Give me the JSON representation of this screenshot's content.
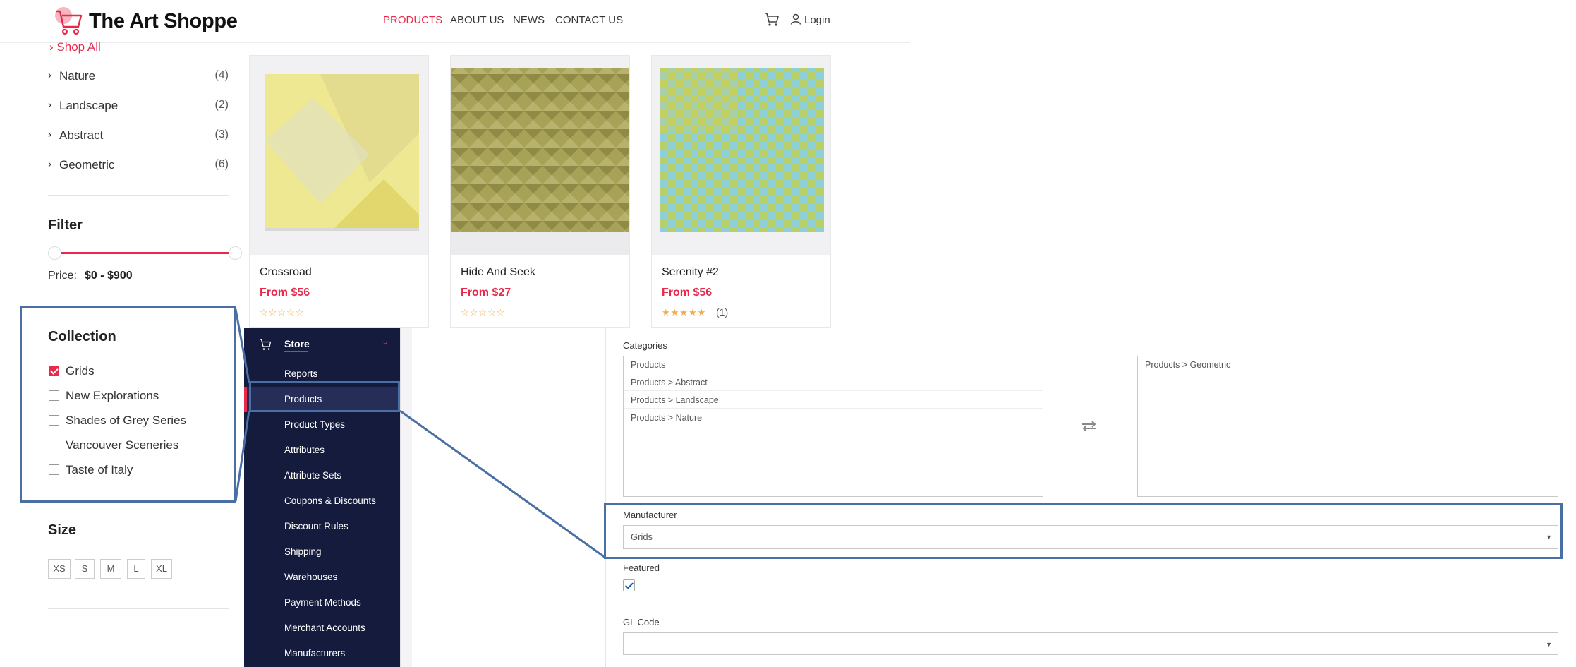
{
  "store": {
    "title": "The Art Shoppe",
    "nav": [
      "PRODUCTS",
      "ABOUT US",
      "NEWS",
      "CONTACT US"
    ],
    "login": "Login",
    "shop_all": "Shop All",
    "categories": [
      {
        "label": "Nature",
        "count": "(4)"
      },
      {
        "label": "Landscape",
        "count": "(2)"
      },
      {
        "label": "Abstract",
        "count": "(3)"
      },
      {
        "label": "Geometric",
        "count": "(6)"
      }
    ],
    "filter_title": "Filter",
    "price_label": "Price:",
    "price_range": "$0 - $900",
    "collection_title": "Collection",
    "collections": [
      {
        "label": "Grids",
        "checked": true
      },
      {
        "label": "New Explorations",
        "checked": false
      },
      {
        "label": "Shades of Grey Series",
        "checked": false
      },
      {
        "label": "Vancouver Sceneries",
        "checked": false
      },
      {
        "label": "Taste of Italy",
        "checked": false
      }
    ],
    "size_title": "Size",
    "sizes": [
      "XS",
      "S",
      "M",
      "L",
      "XL"
    ],
    "products": [
      {
        "name": "Crossroad",
        "price": "From $56",
        "stars": "☆☆☆☆☆",
        "reviews": ""
      },
      {
        "name": "Hide And Seek",
        "price": "From $27",
        "stars": "☆☆☆☆☆",
        "reviews": ""
      },
      {
        "name": "Serenity #2",
        "price": "From $56",
        "stars": "★★★★★",
        "reviews": "(1)"
      }
    ]
  },
  "admin": {
    "store_label": "Store",
    "menu": [
      "Reports",
      "Products",
      "Product Types",
      "Attributes",
      "Attribute Sets",
      "Coupons & Discounts",
      "Discount Rules",
      "Shipping",
      "Warehouses",
      "Payment Methods",
      "Merchant Accounts",
      "Manufacturers"
    ],
    "categories_label": "Categories",
    "available_categories": [
      "Products",
      "Products > Abstract",
      "Products > Landscape",
      "Products > Nature"
    ],
    "selected_categories": [
      "Products > Geometric"
    ],
    "manufacturer_label": "Manufacturer",
    "manufacturer_value": "Grids",
    "featured_label": "Featured",
    "featured_checked": true,
    "gl_code_label": "GL Code",
    "gl_code_value": ""
  },
  "colors": {
    "accent": "#e8294c",
    "admin_nav_bg": "#141b3c",
    "highlight": "#4a6fa5"
  }
}
